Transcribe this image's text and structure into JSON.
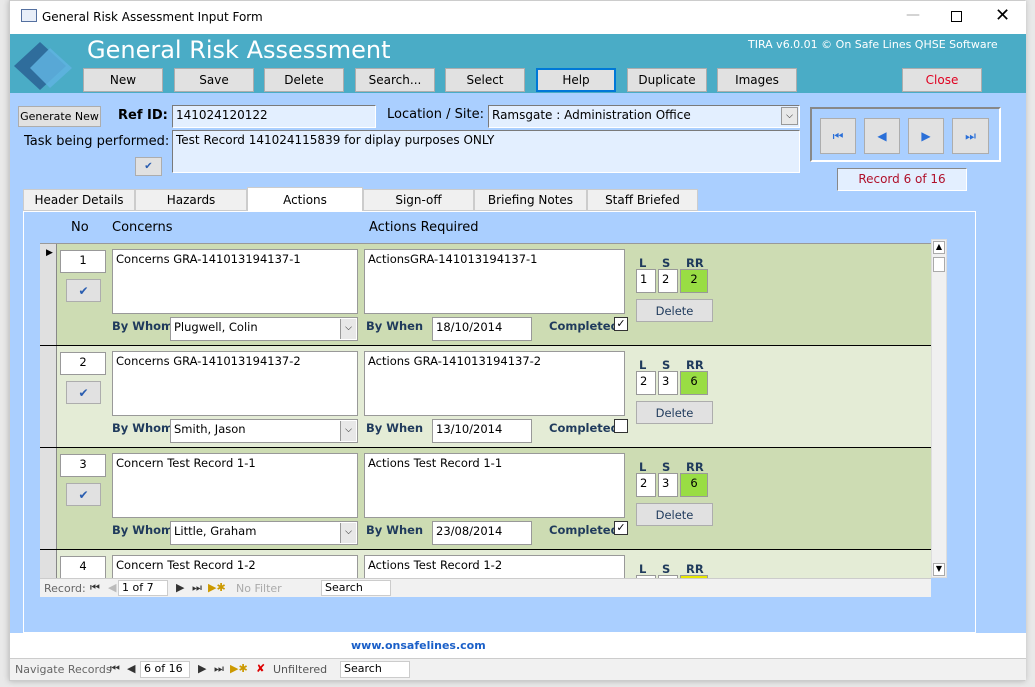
{
  "window": {
    "title": "General Risk Assessment Input Form"
  },
  "header": {
    "title": "General Risk Assessment",
    "version": "TIRA v6.0.01 © On Safe Lines QHSE Software",
    "buttons": [
      "New",
      "Save",
      "Delete",
      "Search...",
      "Select",
      "Help",
      "Duplicate",
      "Images"
    ],
    "close": "Close"
  },
  "form": {
    "generate_new": "Generate New",
    "ref_id_label": "Ref ID:",
    "ref_id": "141024120122",
    "location_label": "Location / Site:",
    "location": "Ramsgate : Administration Office",
    "task_label": "Task being performed:",
    "task": "Test Record 141024115839 for diplay purposes ONLY",
    "record_counter": "Record 6 of 16"
  },
  "tabs": [
    "Header Details",
    "Hazards",
    "Actions",
    "Sign-off",
    "Briefing Notes",
    "Staff Briefed"
  ],
  "subform": {
    "col_no": "No",
    "col_concerns": "Concerns",
    "col_actions": "Actions Required",
    "labels": {
      "by_whom": "By Whom",
      "by_when": "By When",
      "completed": "Completed",
      "l": "L",
      "s": "S",
      "rr": "RR",
      "delete": "Delete"
    },
    "rows": [
      {
        "no": "1",
        "concerns": "Concerns GRA-141013194137-1",
        "actions": "ActionsGRA-141013194137-1",
        "by_whom": "Plugwell, Colin",
        "by_when": "18/10/2014",
        "completed": true,
        "l": "1",
        "s": "2",
        "rr": "2",
        "rr_color": "#99dd44"
      },
      {
        "no": "2",
        "concerns": "Concerns GRA-141013194137-2",
        "actions": "Actions GRA-141013194137-2",
        "by_whom": "Smith, Jason",
        "by_when": "13/10/2014",
        "completed": false,
        "l": "2",
        "s": "3",
        "rr": "6",
        "rr_color": "#99dd44"
      },
      {
        "no": "3",
        "concerns": "Concern Test Record 1-1",
        "actions": "Actions Test Record 1-1",
        "by_whom": "Little, Graham",
        "by_when": "23/08/2014",
        "completed": true,
        "l": "2",
        "s": "3",
        "rr": "6",
        "rr_color": "#99dd44"
      },
      {
        "no": "4",
        "concerns": "Concern Test Record 1-2",
        "actions": "Actions Test Record 1-2",
        "rr_color": "#e8e800"
      }
    ],
    "nav": {
      "label": "Record:",
      "position": "1 of 7",
      "filter": "No Filter",
      "search": "Search"
    }
  },
  "footer": {
    "link": "www.onsafelines.com",
    "nav_label": "Navigate Records",
    "position": "6 of 16",
    "filter": "Unfiltered",
    "search": "Search"
  }
}
